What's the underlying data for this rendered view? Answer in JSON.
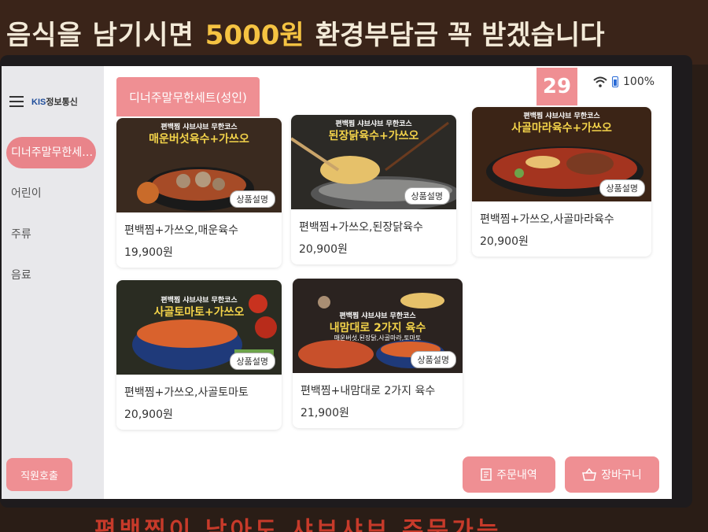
{
  "banner": {
    "part1": "음식을 남기시면",
    "part2": "5000원",
    "part3": "환경부담금 꼭 받겠습니다",
    "bottom": "편백찜이 남아도 샤브샤브 주문가능"
  },
  "header": {
    "logo_prefix": "KIS",
    "logo_suffix": "정보통신",
    "category_tab": "디너주말무한세트(성인)",
    "timer": "29",
    "battery": "100%"
  },
  "sidebar": {
    "items": [
      {
        "label": "디너주말무한세트(성인)"
      },
      {
        "label": "어린이"
      },
      {
        "label": "주류"
      },
      {
        "label": "음료"
      }
    ],
    "staff_call": "직원호출"
  },
  "menu": {
    "info_label": "상품설명",
    "items": [
      {
        "img_top": "편백찜 샤브샤브 무한코스",
        "img_title": "매운버섯육수+가쓰오",
        "name": "편백찜+가쓰오,매운육수",
        "price": "19,900원",
        "bg": "#3a2a1f",
        "accent": "#c9572a"
      },
      {
        "img_top": "편백찜 샤브샤브 무한코스",
        "img_title": "된장닭육수+가쓰오",
        "name": "편백찜+가쓰오,된장닭육수",
        "price": "20,900원",
        "bg": "#2c2a26",
        "accent": "#e6c16a"
      },
      {
        "img_top": "편백찜 샤브샤브 무한코스",
        "img_title": "사골마라육수+가쓰오",
        "name": "편백찜+가쓰오,사골마라육수",
        "price": "20,900원",
        "bg": "#3b2416",
        "accent": "#a4341f"
      },
      {
        "img_top": "편백찜 샤브샤브 무한코스",
        "img_title": "사골토마토+가쓰오",
        "name": "편백찜+가쓰오,사골토마토",
        "price": "20,900원",
        "bg": "#2a2c22",
        "accent": "#d9622d"
      },
      {
        "img_top": "편백찜 샤브샤브 무한코스",
        "img_title": "내맘대로 2가지 육수",
        "img_sub": "매운버섯,된장닭,사골마라,토마토",
        "name": "편백찜+내맘대로 2가지 육수",
        "price": "21,900원",
        "bg": "#2b2320",
        "accent": "#c8502b"
      }
    ]
  },
  "footer": {
    "order_history": "주문내역",
    "cart": "장바구니"
  },
  "colors": {
    "accent": "#ef8f93",
    "sidebar_active": "#e9848a",
    "banner_highlight": "#f5c342"
  }
}
